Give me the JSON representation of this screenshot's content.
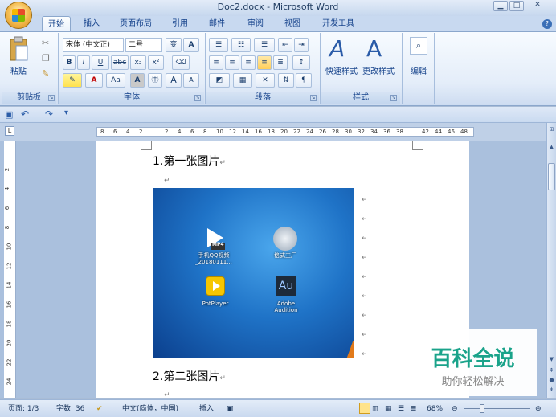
{
  "window": {
    "title": "Doc2.docx - Microsoft Word",
    "min": "▭",
    "max": "□",
    "close": "✕"
  },
  "tabs": [
    "开始",
    "插入",
    "页面布局",
    "引用",
    "邮件",
    "审阅",
    "视图",
    "开发工具"
  ],
  "active_tab": "开始",
  "ribbon": {
    "clipboard": {
      "label": "剪贴板",
      "paste": "粘贴"
    },
    "font": {
      "label": "字体",
      "font_name": "宋体 (中文正)",
      "font_size": "二号",
      "bold": "B",
      "italic": "I",
      "underline": "U",
      "strike": "abc",
      "subscript": "x₂",
      "superscript": "x²",
      "grow": "A",
      "shrink": "A",
      "change_case": "Aa",
      "wen": "变",
      "char_border": "A"
    },
    "paragraph": {
      "label": "段落"
    },
    "styles": {
      "label": "样式",
      "quick": "快速样式",
      "change": "更改样式"
    },
    "editing": {
      "label": "编辑"
    }
  },
  "ruler_ticks": [
    "8",
    "6",
    "4",
    "2",
    "",
    "2",
    "4",
    "6",
    "8",
    "10",
    "12",
    "14",
    "16",
    "18",
    "20",
    "22",
    "24",
    "26",
    "28",
    "30",
    "32",
    "34",
    "36",
    "38",
    "",
    "42",
    "44",
    "46",
    "48"
  ],
  "vruler_ticks": [
    "2",
    "4",
    "6",
    "8",
    "10",
    "12",
    "14",
    "16",
    "18",
    "20",
    "22",
    "24"
  ],
  "document": {
    "heading1": "1.第一张图片",
    "heading2": "2.第二张图片",
    "desktop_icons": [
      {
        "label": "手机QQ视频\n_20180111..."
      },
      {
        "label": "格式工厂"
      },
      {
        "label": "PotPlayer"
      },
      {
        "label": "Adobe\nAudition"
      }
    ],
    "mp4_badge": "MP4",
    "au_badge": "Au"
  },
  "watermark": {
    "title": "百科全说",
    "subtitle": "助你轻松解决"
  },
  "status": {
    "page": "页面: 1/3",
    "words": "字数: 36",
    "language": "中文(简体，中国)",
    "mode": "插入",
    "zoom": "68%"
  }
}
